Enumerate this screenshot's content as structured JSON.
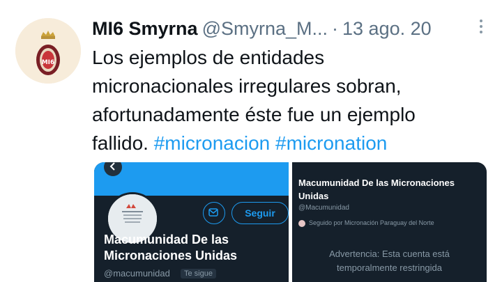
{
  "tweet": {
    "author_name": "MI6 Smyrna",
    "author_handle": "@Smyrna_M...",
    "separator": "·",
    "date": "13 ago. 20",
    "text_lines": [
      "Los ejemplos de entidades",
      "micronacionales irregulares sobran,",
      "afortunadamente éste fue un ejemplo",
      "fallido."
    ],
    "hashtags": [
      "#micronacion",
      "#micronation"
    ],
    "avatar_logo_text": "MI6"
  },
  "media_left": {
    "display_name": "Macumunidad De las Micronaciones Unidas",
    "handle": "@macumunidad",
    "follows_you_tag": "Te sigue",
    "follow_button": "Seguir"
  },
  "media_right": {
    "display_name": "Macumunidad De las Micronaciones Unidas",
    "handle": "@Macumunidad",
    "followed_by": "Seguido por Micronación Paraguay del Norte",
    "warning_line1": "Advertencia: Esta cuenta está",
    "warning_line2": "temporalmente restringida"
  },
  "colors": {
    "hashtag": "#1d9bf0",
    "dark_bg": "#15202b",
    "banner": "#1d9bf0",
    "muted": "#5b7083"
  }
}
